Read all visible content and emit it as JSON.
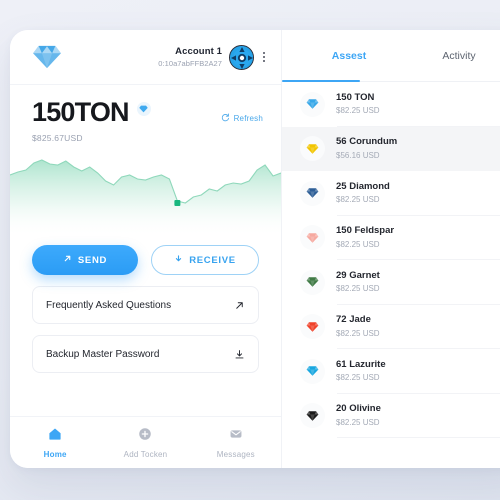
{
  "theme": {
    "accent": "#3da6f5",
    "accent_dark": "#2b9cf5",
    "chart_green": "#3fc79a",
    "page_bg": "#e9ecf4",
    "card_bg": "#ffffff",
    "muted_text": "#a4aab6"
  },
  "wallet": {
    "logo_icon": "diamond-logo-icon",
    "account": {
      "name": "Account 1",
      "address": "0:10a7abFFB2A27",
      "avatar_icon": "avatar-icon",
      "menu_icon": "more-vertical-icon"
    },
    "balance": {
      "amount": "150TON",
      "fiat": "$825.67USD",
      "badge_icon": "diamond-icon",
      "refresh_label": "Refresh",
      "refresh_icon": "refresh-icon"
    },
    "actions": [
      {
        "label": "SEND",
        "icon": "arrow-up-right-icon",
        "style": "primary"
      },
      {
        "label": "RECEIVE",
        "icon": "arrow-down-icon",
        "style": "outline"
      }
    ],
    "links": [
      {
        "label": "Frequently Asked Questions",
        "icon": "arrow-up-right-icon"
      },
      {
        "label": "Backup Master Password",
        "icon": "download-icon"
      }
    ],
    "nav": [
      {
        "label": "Home",
        "icon": "home-icon",
        "active": true
      },
      {
        "label": "Add Tocken",
        "icon": "plus-circle-icon",
        "active": false
      },
      {
        "label": "Messages",
        "icon": "envelope-icon",
        "active": false
      }
    ]
  },
  "assets_panel": {
    "tabs": [
      {
        "label": "Assest",
        "active": true
      },
      {
        "label": "Activity",
        "active": false
      }
    ],
    "rows": [
      {
        "name": "150 TON",
        "value": "$82.25 USD",
        "gem_color": "#38a8e8",
        "highlight": false
      },
      {
        "name": "56 Corundum",
        "value": "$56.16 USD",
        "gem_color": "#f2c500",
        "highlight": true
      },
      {
        "name": "25 Diamond",
        "value": "$82.25 USD",
        "gem_color": "#2d5e96",
        "highlight": false
      },
      {
        "name": "150 Feldspar",
        "value": "$82.25 USD",
        "gem_color": "#f6a9a0",
        "highlight": false
      },
      {
        "name": "29 Garnet",
        "value": "$82.25 USD",
        "gem_color": "#3f7a45",
        "highlight": false
      },
      {
        "name": "72 Jade",
        "value": "$82.25 USD",
        "gem_color": "#f0422a",
        "highlight": false
      },
      {
        "name": "61 Lazurite",
        "value": "$82.25 USD",
        "gem_color": "#19a7e0",
        "highlight": false
      },
      {
        "name": "20 Olivine",
        "value": "$82.25 USD",
        "gem_color": "#1b1b1b",
        "highlight": false
      }
    ]
  },
  "chart_data": {
    "type": "area",
    "title": "",
    "xlabel": "",
    "ylabel": "",
    "grid": false,
    "legend": "none",
    "line_color": "#3fc79a",
    "fill_top": "#bfead8",
    "fill_bottom": "#ffffff",
    "ylim": [
      0,
      100
    ],
    "x": [
      0,
      1,
      2,
      3,
      4,
      5,
      6,
      7,
      8,
      9,
      10,
      11,
      12,
      13,
      14,
      15,
      16,
      17,
      18,
      19,
      20,
      21,
      22,
      23,
      24,
      25,
      26,
      27,
      28,
      29,
      30,
      31,
      32,
      33,
      34
    ],
    "values": [
      68,
      70,
      72,
      80,
      83,
      79,
      78,
      82,
      76,
      72,
      76,
      70,
      62,
      58,
      66,
      68,
      64,
      63,
      66,
      68,
      64,
      40,
      38,
      44,
      46,
      52,
      50,
      56,
      58,
      57,
      60,
      72,
      78,
      66,
      70
    ],
    "marker": {
      "x": 23,
      "y": 40,
      "color": "#18b77e"
    }
  }
}
